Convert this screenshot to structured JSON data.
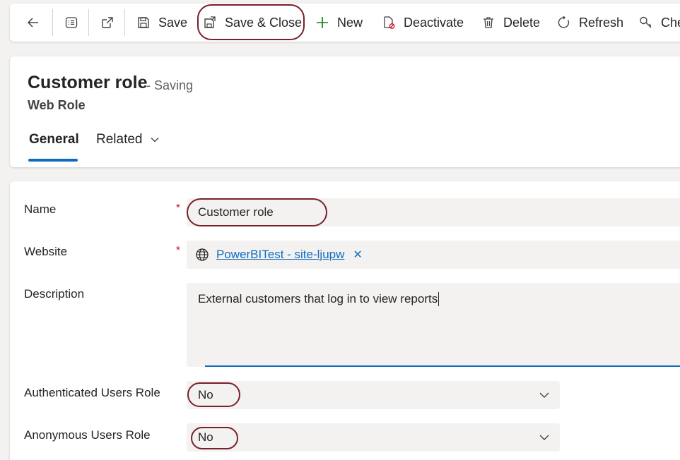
{
  "toolbar": {
    "save": "Save",
    "save_close": "Save & Close",
    "new": "New",
    "deactivate": "Deactivate",
    "delete": "Delete",
    "refresh": "Refresh",
    "check": "Che"
  },
  "header": {
    "title": "Customer role",
    "status": "- Saving",
    "entity": "Web Role",
    "tabs": [
      "General",
      "Related"
    ]
  },
  "form": {
    "name_label": "Name",
    "name_value": "Customer role",
    "website_label": "Website",
    "website_value": "PowerBITest - site-ljupw",
    "description_label": "Description",
    "description_value": "External customers that log in to view reports",
    "auth_label": "Authenticated Users Role",
    "auth_value": "No",
    "anon_label": "Anonymous Users Role",
    "anon_value": "No",
    "required_marker": "*"
  },
  "colors": {
    "accent": "#0f6cbd",
    "highlight": "#7a1f2b",
    "required": "#c50f1f"
  }
}
